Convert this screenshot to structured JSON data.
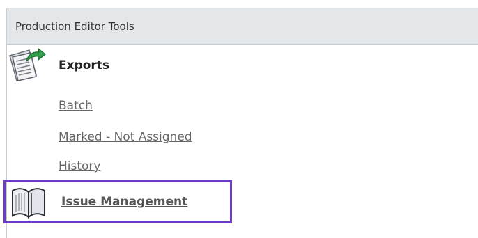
{
  "panel": {
    "title": "Production Editor Tools"
  },
  "sections": {
    "exports": {
      "icon": "export-document-icon",
      "title": "Exports",
      "links": {
        "batch": "Batch",
        "marked_not_assigned": "Marked - Not Assigned",
        "history": "History"
      }
    },
    "issue_management": {
      "icon": "open-book-icon",
      "title": "Issue Management",
      "highlight_color": "#6c3ac8"
    }
  },
  "colors": {
    "header_bg": "#e3e7ea",
    "border": "#c7ccd1",
    "link_text": "#666666",
    "icon_green": "#2e9e4a"
  }
}
